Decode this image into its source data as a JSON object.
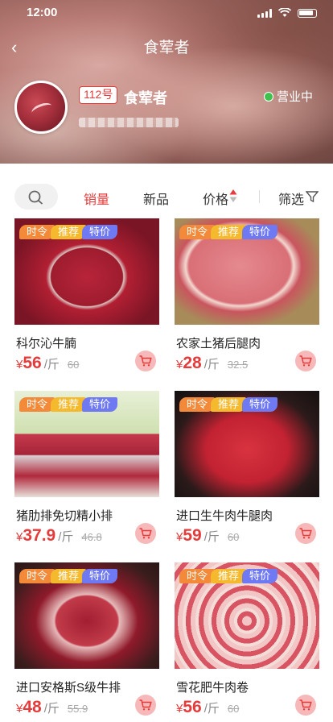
{
  "status_bar": {
    "time": "12:00"
  },
  "nav": {
    "title": "食荤者"
  },
  "shop": {
    "store_no": "112号",
    "name": "食荤者",
    "status": "营业中"
  },
  "sort_tabs": [
    {
      "label": "销量",
      "active": true
    },
    {
      "label": "新品"
    },
    {
      "label": "价格"
    },
    {
      "label": "筛选"
    }
  ],
  "tags": [
    "时令",
    "推荐",
    "特价"
  ],
  "products": [
    {
      "name": "科尔沁牛腩",
      "currency": "¥",
      "price": "56",
      "unit": "/斤",
      "old_price": "60"
    },
    {
      "name": "农家土猪后腿肉",
      "currency": "¥",
      "price": "28",
      "unit": "/斤",
      "old_price": "32.5"
    },
    {
      "name": "猪肋排免切精小排",
      "currency": "¥",
      "price": "37.9",
      "unit": "/斤",
      "old_price": "46.8"
    },
    {
      "name": "进口生牛肉牛腿肉",
      "currency": "¥",
      "price": "59",
      "unit": "/斤",
      "old_price": "60"
    },
    {
      "name": "进口安格斯S级牛排",
      "currency": "¥",
      "price": "48",
      "unit": "/斤",
      "old_price": "55.9"
    },
    {
      "name": "雪花肥牛肉卷",
      "currency": "¥",
      "price": "56",
      "unit": "/斤",
      "old_price": "60"
    }
  ],
  "colors": {
    "accent": "#e53b3b",
    "tag_seasonal": "#f28a3a",
    "tag_recommend": "#f5b92e",
    "tag_special": "#6f79f2",
    "open_dot": "#3ec24d"
  }
}
